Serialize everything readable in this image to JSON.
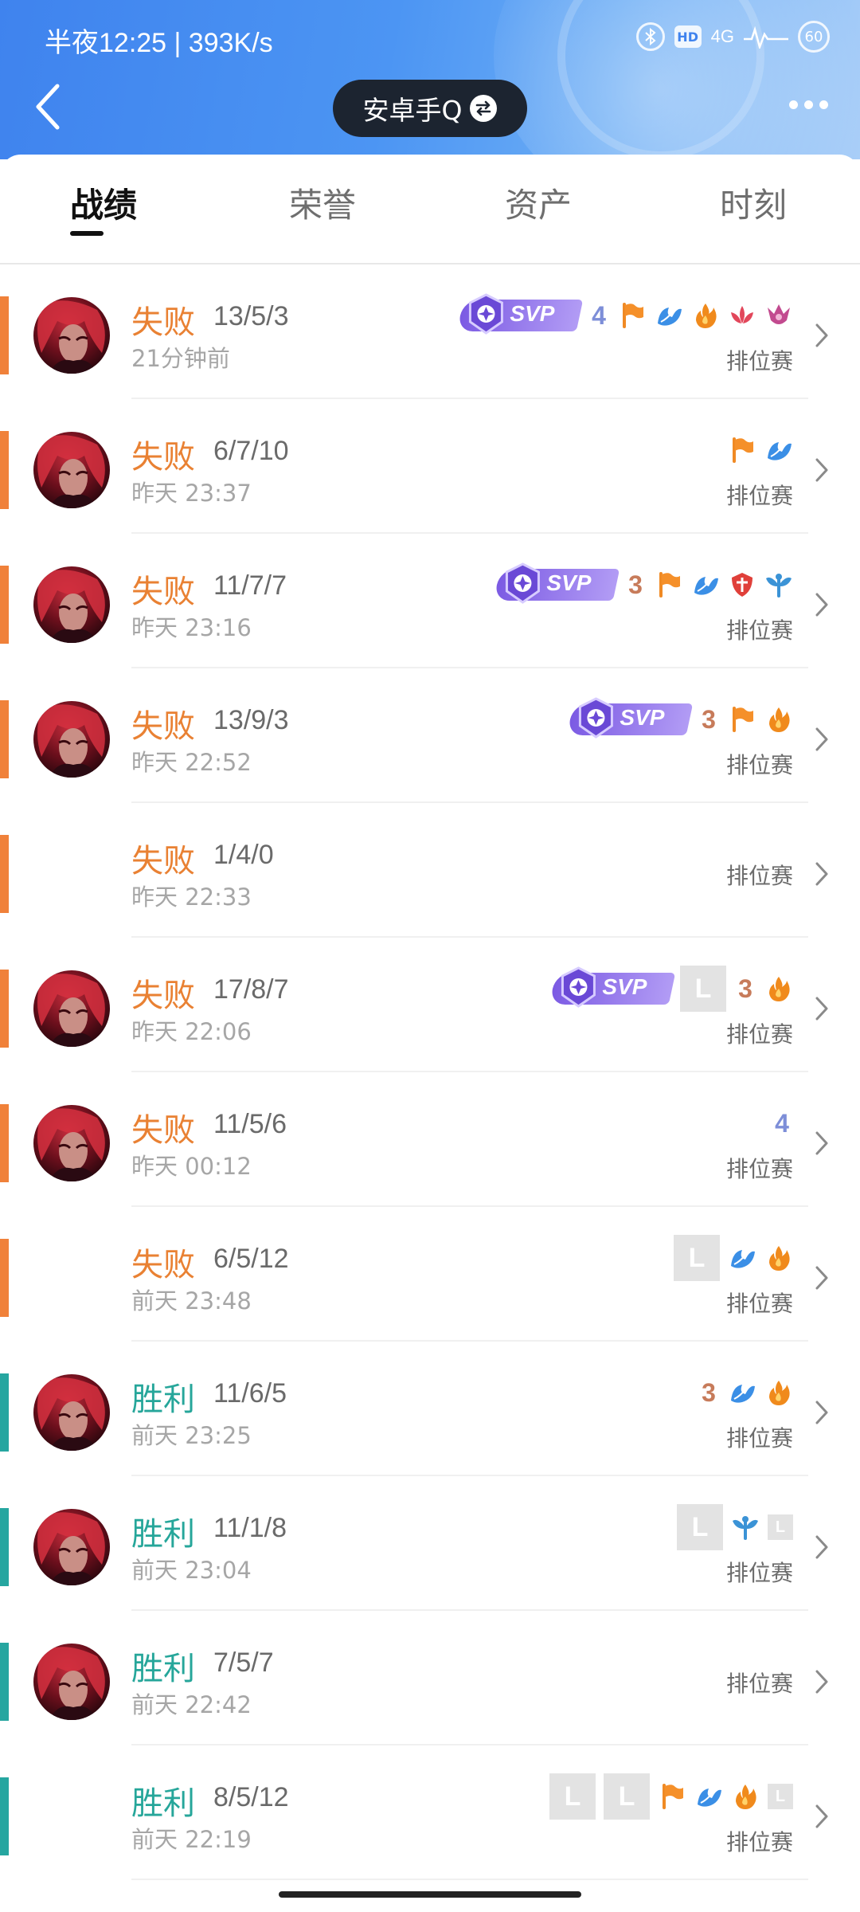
{
  "status_bar": {
    "time_speed": "半夜12:25 | 393K/s",
    "network": "4G",
    "battery": "60"
  },
  "header": {
    "account_name": "安卓手Q"
  },
  "tabs": [
    {
      "label": "战绩",
      "active": true
    },
    {
      "label": "荣誉",
      "active": false
    },
    {
      "label": "资产",
      "active": false
    },
    {
      "label": "时刻",
      "active": false
    }
  ],
  "colors": {
    "loss": "#e98133",
    "win": "#26a69a",
    "header_blue": "#4c95f3"
  },
  "matches": [
    {
      "result": "失败",
      "outcome": "loss",
      "kda": "13/5/3",
      "time": "21分钟前",
      "mode": "排位赛",
      "avatar": true,
      "badges": [
        "svp",
        "4",
        "flag-icon",
        "leaf-icon",
        "fire-icon",
        "lotus-icon",
        "crown-icon"
      ]
    },
    {
      "result": "失败",
      "outcome": "loss",
      "kda": "6/7/10",
      "time": "昨天 23:37",
      "mode": "排位赛",
      "avatar": true,
      "badges": [
        "flag-icon",
        "leaf-icon"
      ]
    },
    {
      "result": "失败",
      "outcome": "loss",
      "kda": "11/7/7",
      "time": "昨天 23:16",
      "mode": "排位赛",
      "avatar": true,
      "badges": [
        "svp",
        "3",
        "flag-icon",
        "leaf-icon",
        "shield-icon",
        "wings-icon"
      ]
    },
    {
      "result": "失败",
      "outcome": "loss",
      "kda": "13/9/3",
      "time": "昨天 22:52",
      "mode": "排位赛",
      "avatar": true,
      "badges": [
        "svp",
        "3",
        "flag-icon",
        "fire-icon"
      ]
    },
    {
      "result": "失败",
      "outcome": "loss",
      "kda": "1/4/0",
      "time": "昨天 22:33",
      "mode": "排位赛",
      "avatar": false,
      "badges": []
    },
    {
      "result": "失败",
      "outcome": "loss",
      "kda": "17/8/7",
      "time": "昨天 22:06",
      "mode": "排位赛",
      "avatar": true,
      "badges": [
        "svp",
        "L",
        "3",
        "fire-icon"
      ]
    },
    {
      "result": "失败",
      "outcome": "loss",
      "kda": "11/5/6",
      "time": "昨天 00:12",
      "mode": "排位赛",
      "avatar": true,
      "badges": [
        "4"
      ]
    },
    {
      "result": "失败",
      "outcome": "loss",
      "kda": "6/5/12",
      "time": "前天 23:48",
      "mode": "排位赛",
      "avatar": false,
      "badges": [
        "L",
        "leaf-icon",
        "fire-icon"
      ]
    },
    {
      "result": "胜利",
      "outcome": "win",
      "kda": "11/6/5",
      "time": "前天 23:25",
      "mode": "排位赛",
      "avatar": true,
      "badges": [
        "3",
        "leaf-icon",
        "fire-icon"
      ]
    },
    {
      "result": "胜利",
      "outcome": "win",
      "kda": "11/1/8",
      "time": "前天 23:04",
      "mode": "排位赛",
      "avatar": true,
      "badges": [
        "L",
        "wings-icon",
        "l"
      ]
    },
    {
      "result": "胜利",
      "outcome": "win",
      "kda": "7/5/7",
      "time": "前天 22:42",
      "mode": "排位赛",
      "avatar": true,
      "badges": []
    },
    {
      "result": "胜利",
      "outcome": "win",
      "kda": "8/5/12",
      "time": "前天 22:19",
      "mode": "排位赛",
      "avatar": false,
      "badges": [
        "L",
        "L",
        "flag-icon",
        "leaf-icon",
        "fire-icon",
        "l"
      ]
    }
  ]
}
